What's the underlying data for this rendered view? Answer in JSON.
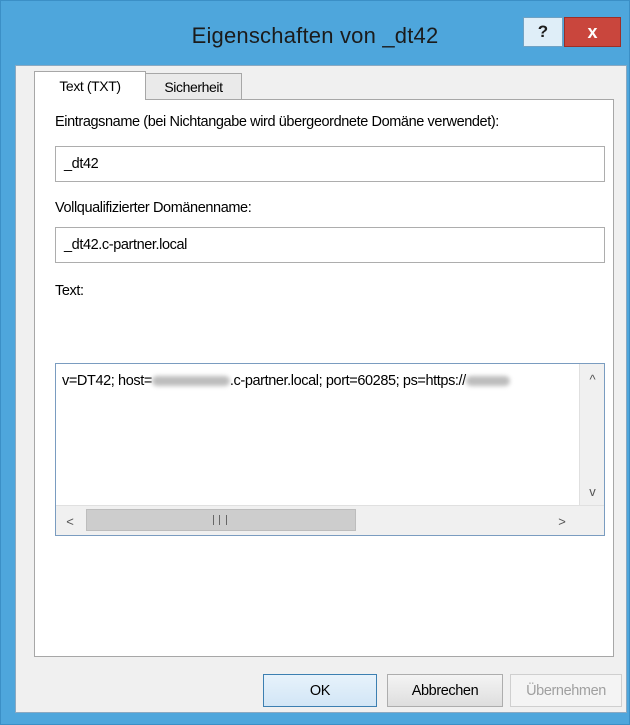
{
  "window": {
    "title": "Eigenschaften von _dt42",
    "help_label": "?",
    "close_label": "x"
  },
  "tabs": [
    {
      "label": "Text (TXT)",
      "active": true
    },
    {
      "label": "Sicherheit",
      "active": false
    }
  ],
  "form": {
    "entry_name_label": "Eintragsname (bei Nichtangabe wird übergeordnete Domäne verwendet):",
    "entry_name_value": "_dt42",
    "fqdn_label": "Vollqualifizierter Domänenname:",
    "fqdn_value": "_dt42.c-partner.local",
    "text_label": "Text:",
    "text_value_part1": "v=DT42; host=",
    "text_value_part2": ".c-partner.local; port=60285; ps=https://"
  },
  "buttons": {
    "ok": "OK",
    "cancel": "Abbrechen",
    "apply": "Übernehmen"
  },
  "scrollbar": {
    "up": "^",
    "down": "v",
    "left": "<",
    "right": ">"
  }
}
